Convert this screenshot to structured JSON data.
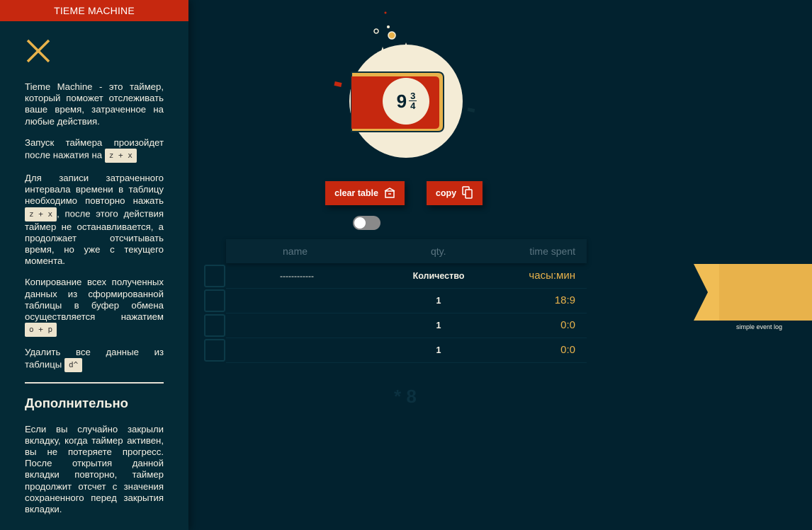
{
  "sidebar": {
    "title": "TIEME MACHINE",
    "intro": "Tieme Machine - это таймер, который поможет отслеживать ваше время, затраченное на любые действия.",
    "start_text": "Запуск таймера произойдет после нажатия на",
    "start_key": "z + x",
    "record_text_before": "Для записи затраченного интервала времени в таблицу необходимо повторно нажать",
    "record_key": "z + x",
    "record_text_after": ", после этого действия таймер не останавливается, а продолжает отсчитывать время, но уже с текущего момента.",
    "copy_text": "Копирование всех полученных данных из сформированной таблицы в буфер обмена осуществляется нажатием",
    "copy_key": "o + p",
    "delete_text": "Удалить все данные из таблицы",
    "delete_key": "d^",
    "extra_title": "Дополнительно",
    "extra_text": "Если вы случайно закрыли вкладку, когда таймер активен, вы не потеряете прогресс. После открытия данной вкладки повторно, таймер продолжит отсчет с значения сохраненного перед закрытия вкладки."
  },
  "timer": {
    "whole": "9",
    "numerator": "3",
    "denominator": "4"
  },
  "actions": {
    "clear_label": "clear table",
    "copy_label": "copy"
  },
  "toggle": {
    "on": false
  },
  "table": {
    "headers": {
      "name": "name",
      "qty": "qty.",
      "time": "time spent"
    },
    "rows": [
      {
        "name": "------------",
        "qty": "Количество",
        "time": "часы:мин"
      },
      {
        "name": "",
        "qty": "1",
        "time": "18:9"
      },
      {
        "name": "",
        "qty": "1",
        "time": "0:0"
      },
      {
        "name": "",
        "qty": "1",
        "time": "0:0"
      }
    ]
  },
  "ghost_text": "* 8",
  "ribbon": {
    "label": "simple event log"
  },
  "colors": {
    "background": "#02222f",
    "sidebar": "#042a36",
    "accent_red": "#c6280f",
    "accent_gold": "#e8b24b",
    "cream": "#f4ecd6"
  },
  "icons": [
    "close-icon",
    "clear-box-icon",
    "copy-icon"
  ]
}
